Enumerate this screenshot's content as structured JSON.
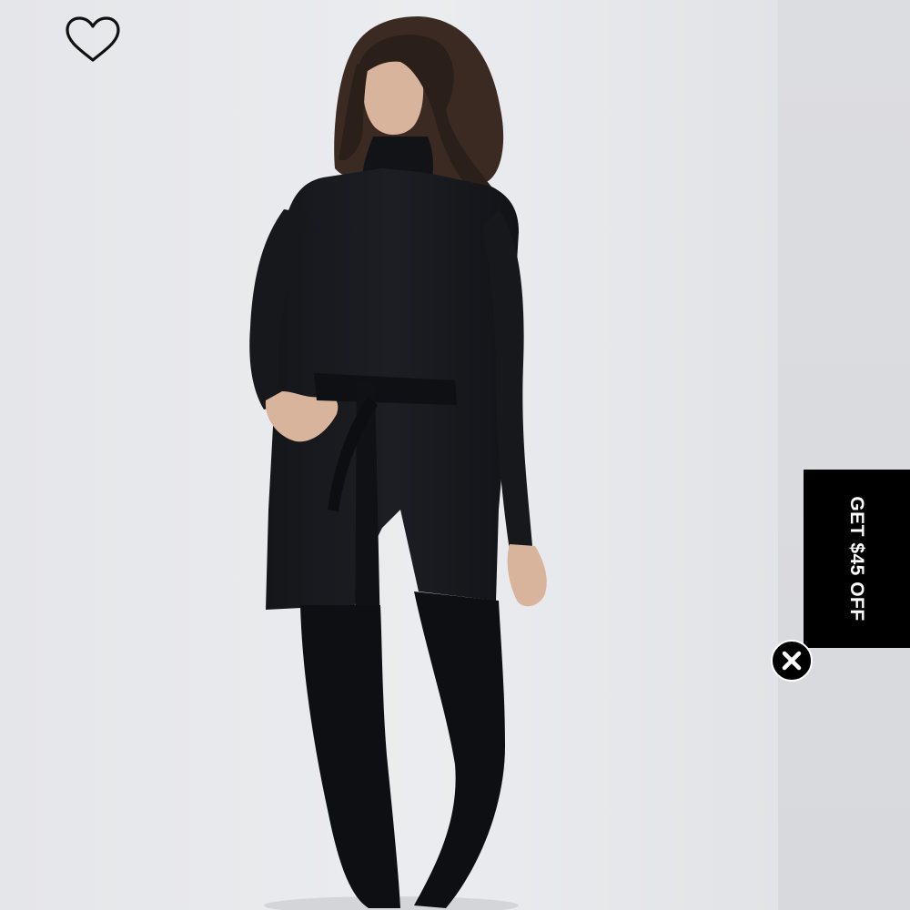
{
  "product_image": {
    "alt_name": "model-photo"
  },
  "wishlist": {
    "icon": "heart-outline-icon"
  },
  "promo": {
    "label": "GET $45 OFF",
    "background": "#000000",
    "text_color": "#ffffff"
  },
  "promo_close": {
    "icon": "close-icon"
  }
}
